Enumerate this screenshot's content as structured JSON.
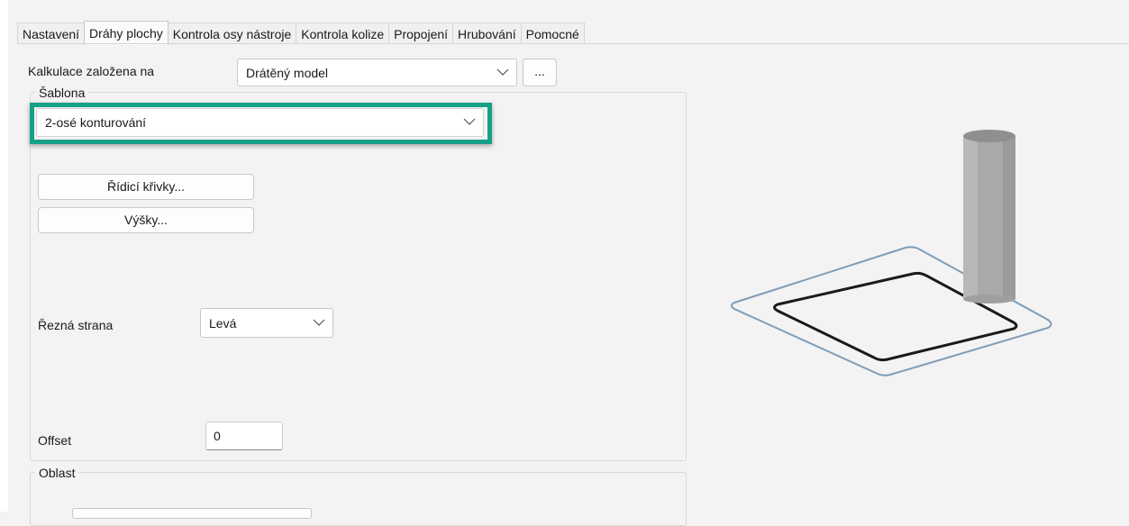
{
  "tabs": [
    {
      "label": "Nastavení",
      "active": false
    },
    {
      "label": "Dráhy plochy",
      "active": true
    },
    {
      "label": "Kontrola osy nástroje",
      "active": false
    },
    {
      "label": "Kontrola kolize",
      "active": false
    },
    {
      "label": "Propojení",
      "active": false
    },
    {
      "label": "Hrubování",
      "active": false
    },
    {
      "label": "Pomocné",
      "active": false
    }
  ],
  "calculation": {
    "label": "Kalkulace založena na",
    "value": "Drátěný model",
    "more_button": "..."
  },
  "template_group": {
    "legend": "Šablona",
    "value": "2-osé konturování",
    "guide_curves_button": "Řídicí křivky...",
    "heights_button": "Výšky..."
  },
  "cut_side": {
    "label": "Řezná strana",
    "value": "Levá"
  },
  "offset": {
    "label": "Offset",
    "value": "0"
  },
  "area_group": {
    "legend": "Oblast"
  },
  "colors": {
    "highlight": "#16a085",
    "plane_outline": "#7f9cb8",
    "contour": "#1a1a1a",
    "tool": "#a7a7a7"
  },
  "icons": {
    "dropdown": "chevron-down-icon",
    "preview": "contour-toolpath-preview"
  }
}
